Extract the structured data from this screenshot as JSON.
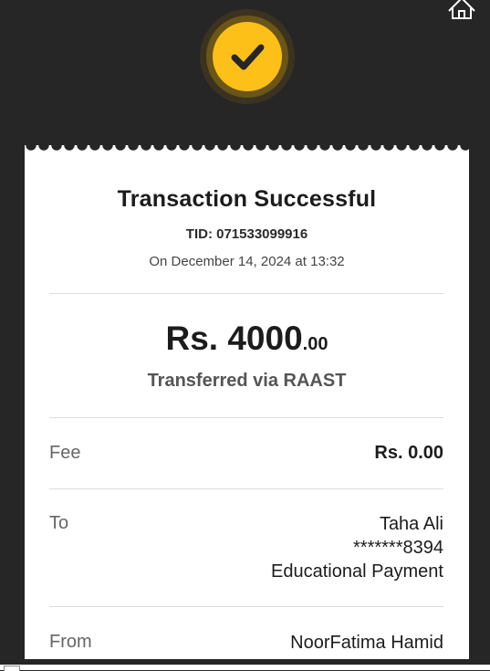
{
  "header": {
    "home_icon": "home-icon",
    "status_icon": "checkmark-circle-icon",
    "accent_color": "#fcc019"
  },
  "receipt": {
    "title": "Transaction Successful",
    "tid": "TID: 071533099916",
    "date": "On December 14, 2024 at 13:32",
    "amount_main": "Rs. 4000",
    "amount_decimal": ".00",
    "transfer_method": "Transferred via RAAST",
    "rows": [
      {
        "label": "Fee",
        "value": "Rs. 0.00"
      },
      {
        "label": "To",
        "name": "Taha Ali",
        "account": "*******8394",
        "purpose": "Educational Payment"
      },
      {
        "label": "From",
        "name": "NoorFatima Hamid"
      }
    ]
  }
}
